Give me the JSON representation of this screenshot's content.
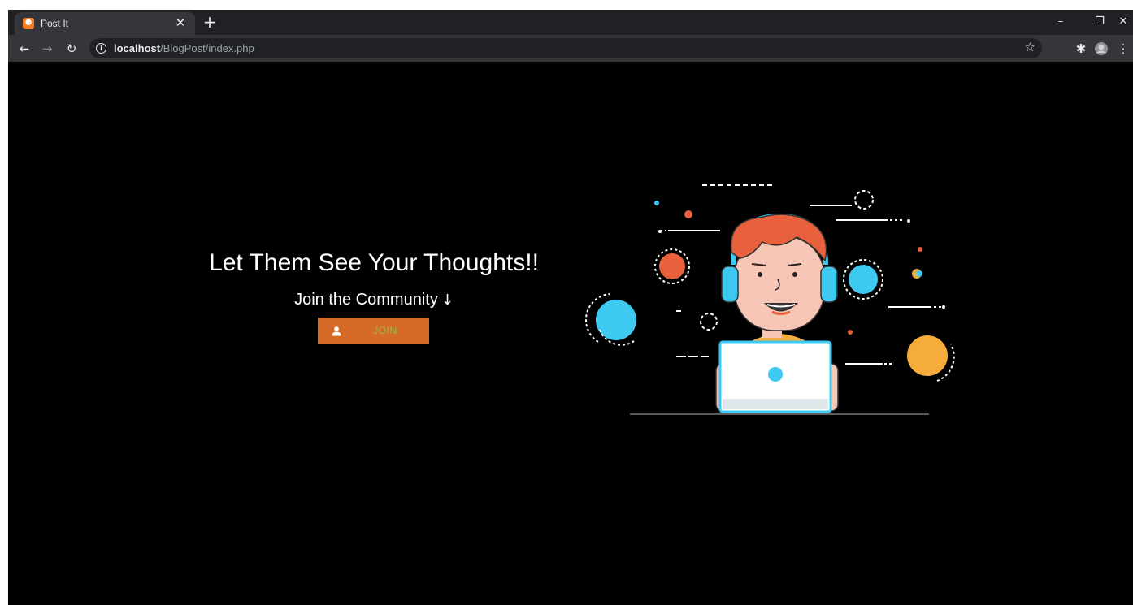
{
  "browser": {
    "tab_title": "Post It",
    "favicon_text": "⚈",
    "tab_close_icon": "✕",
    "new_tab_icon": "+",
    "window_controls": {
      "minimize": "–",
      "restore": "❐",
      "close": "✕"
    },
    "nav": {
      "back": "←",
      "forward": "→",
      "reload": "↻"
    },
    "address": {
      "host": "localhost",
      "path": "/BlogPost/index.php",
      "info_icon": "i"
    },
    "bookmark_icon": "☆",
    "extensions_icon": "✱",
    "menu_icon": "⋮"
  },
  "hero": {
    "headline": "Let Them See Your Thoughts!!",
    "subheading": "Join the Community",
    "subheading_arrow": "↓",
    "join_button_label": "JOIN"
  },
  "colors": {
    "page_background": "#000000",
    "join_button": "#d66a28",
    "join_label": "#8fbd48",
    "accent_blue": "#3ec9f0",
    "accent_orange": "#e8603c",
    "accent_yellow": "#f5ac3b"
  },
  "icons": {
    "join_button_icon": "user-icon",
    "illustration": "person-at-laptop-with-headset"
  }
}
